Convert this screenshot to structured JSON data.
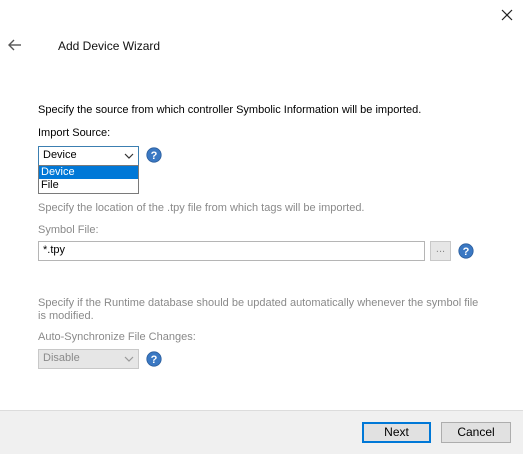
{
  "header": {
    "title": "Add Device Wizard"
  },
  "import_source": {
    "description": "Specify the source from which controller Symbolic Information will be imported.",
    "label": "Import Source:",
    "selected": "Device",
    "options": [
      "Device",
      "File"
    ]
  },
  "symbol_file": {
    "description": "Specify the location of the .tpy file from which tags will be imported.",
    "label": "Symbol File:",
    "value": "*.tpy",
    "browse_label": "..."
  },
  "auto_sync": {
    "description": "Specify if the Runtime database should be updated automatically whenever the symbol file is modified.",
    "label": "Auto-Synchronize File Changes:",
    "selected": "Disable"
  },
  "footer": {
    "next_label": "Next",
    "cancel_label": "Cancel"
  },
  "colors": {
    "accent": "#0078d7",
    "help_icon": "#3a78c3",
    "footer_bg": "#f0f0f0"
  }
}
